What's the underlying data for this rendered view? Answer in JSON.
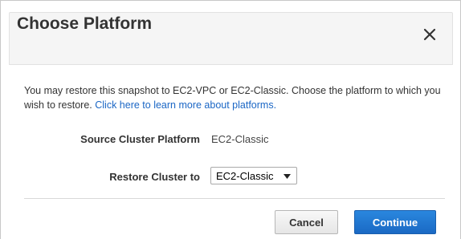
{
  "dialog": {
    "title": "Choose Platform",
    "close_icon": "close-icon"
  },
  "description": {
    "text": "You may restore this snapshot to EC2-VPC or EC2-Classic. Choose the platform to which you wish to restore.",
    "link_text": "Click here to learn more about platforms."
  },
  "fields": {
    "source_label": "Source Cluster Platform",
    "source_value": "EC2-Classic",
    "restore_label": "Restore Cluster to",
    "restore_selected": "EC2-Classic"
  },
  "buttons": {
    "cancel": "Cancel",
    "continue": "Continue"
  },
  "colors": {
    "link": "#1a66c5",
    "primary_button": "#1a69c4",
    "header_bg": "#f5f5f5"
  }
}
